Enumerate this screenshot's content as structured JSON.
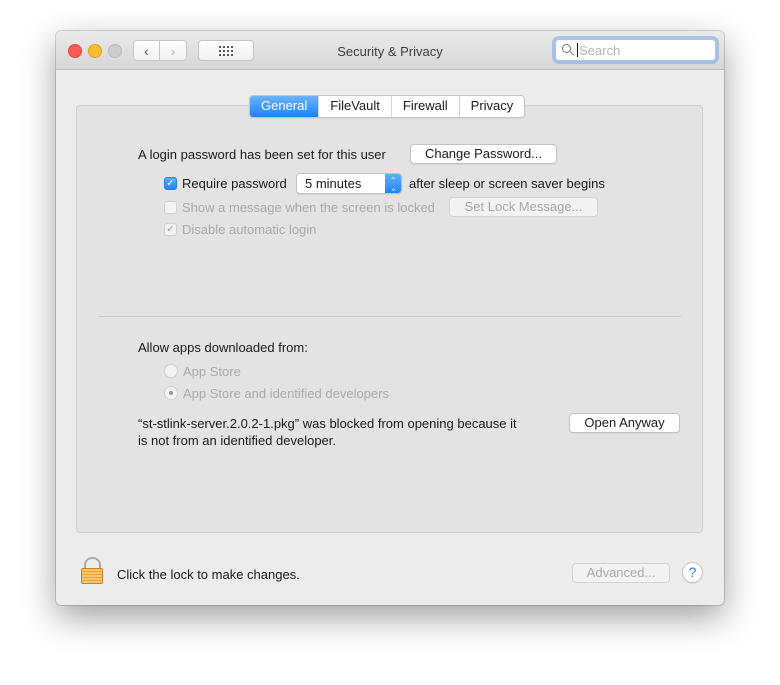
{
  "window": {
    "title": "Security & Privacy",
    "search": {
      "placeholder": "Search",
      "value": ""
    },
    "nav": {
      "back": "‹",
      "forward": "›"
    }
  },
  "tabs": [
    {
      "label": "General",
      "active": true
    },
    {
      "label": "FileVault",
      "active": false
    },
    {
      "label": "Firewall",
      "active": false
    },
    {
      "label": "Privacy",
      "active": false
    }
  ],
  "general": {
    "login_password_text": "A login password has been set for this user",
    "change_password_label": "Change Password...",
    "require_password": {
      "label": "Require password",
      "checked": true
    },
    "require_password_delay": {
      "selected": "5 minutes"
    },
    "after_sleep_text": "after sleep or screen saver begins",
    "show_message": {
      "label": "Show a message when the screen is locked",
      "checked": false,
      "enabled": false
    },
    "set_lock_message_label": "Set Lock Message...",
    "disable_auto_login": {
      "label": "Disable automatic login",
      "checked": true,
      "enabled": false
    },
    "allow_apps_heading": "Allow apps downloaded from:",
    "allow_options": [
      {
        "label": "App Store",
        "selected": false
      },
      {
        "label": "App Store and identified developers",
        "selected": true
      }
    ],
    "blocked_message_line1": "“st-stlink-server.2.0.2-1.pkg” was blocked from opening because it",
    "blocked_message_line2": "is not from an identified developer.",
    "open_anyway_label": "Open Anyway"
  },
  "footer": {
    "lock_text": "Click the lock to make changes.",
    "advanced_label": "Advanced...",
    "help_label": "?"
  },
  "colors": {
    "accent": "#1a82fb",
    "close": "#fc5b57",
    "minimize": "#fdbc2f",
    "zoom": "#cdcdcd"
  }
}
